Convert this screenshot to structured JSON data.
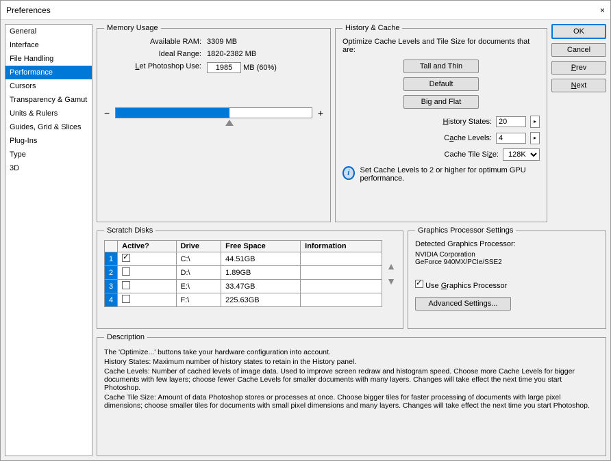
{
  "title": "Preferences",
  "sidebar": {
    "items": [
      {
        "label": "General"
      },
      {
        "label": "Interface"
      },
      {
        "label": "File Handling"
      },
      {
        "label": "Performance",
        "selected": true
      },
      {
        "label": "Cursors"
      },
      {
        "label": "Transparency & Gamut"
      },
      {
        "label": "Units & Rulers"
      },
      {
        "label": "Guides, Grid & Slices"
      },
      {
        "label": "Plug-Ins"
      },
      {
        "label": "Type"
      },
      {
        "label": "3D"
      }
    ]
  },
  "actions": {
    "ok": "OK",
    "cancel": "Cancel",
    "prev": "Prev",
    "next": "Next"
  },
  "memory": {
    "legend": "Memory Usage",
    "avail_label": "Available RAM:",
    "avail_value": "3309 MB",
    "ideal_label": "Ideal Range:",
    "ideal_value": "1820-2382 MB",
    "let_label": "Let Photoshop Use:",
    "let_value": "1985",
    "let_suffix": "MB (60%)"
  },
  "history": {
    "legend": "History & Cache",
    "intro": "Optimize Cache Levels and Tile Size for documents that are:",
    "btn_tall": "Tall and Thin",
    "btn_default": "Default",
    "btn_big": "Big and Flat",
    "hs_label": "History States:",
    "hs_value": "20",
    "cl_label": "Cache Levels:",
    "cl_value": "4",
    "cts_label": "Cache Tile Size:",
    "cts_value": "128K",
    "note": "Set Cache Levels to 2 or higher for optimum GPU performance."
  },
  "scratch": {
    "legend": "Scratch Disks",
    "cols": {
      "active": "Active?",
      "drive": "Drive",
      "free": "Free Space",
      "info": "Information"
    },
    "rows": [
      {
        "n": "1",
        "active": true,
        "drive": "C:\\",
        "free": "44.51GB",
        "info": ""
      },
      {
        "n": "2",
        "active": false,
        "drive": "D:\\",
        "free": "1.89GB",
        "info": ""
      },
      {
        "n": "3",
        "active": false,
        "drive": "E:\\",
        "free": "33.47GB",
        "info": ""
      },
      {
        "n": "4",
        "active": false,
        "drive": "F:\\",
        "free": "225.63GB",
        "info": ""
      }
    ]
  },
  "gpu": {
    "legend": "Graphics Processor Settings",
    "detected_label": "Detected Graphics Processor:",
    "vendor": "NVIDIA Corporation",
    "model": "GeForce 940MX/PCIe/SSE2",
    "use_label": "Use Graphics Processor",
    "use_checked": true,
    "adv": "Advanced Settings..."
  },
  "desc": {
    "legend": "Description",
    "p1": "The 'Optimize...' buttons take your hardware configuration into account.",
    "p2": "History States: Maximum number of history states to retain in the History panel.",
    "p3": "Cache Levels: Number of cached levels of image data.  Used to improve screen redraw and histogram speed.  Choose more Cache Levels for bigger documents with few layers; choose fewer Cache Levels for smaller documents with many layers. Changes will take effect the next time you start Photoshop.",
    "p4": "Cache Tile Size: Amount of data Photoshop stores or processes at once. Choose bigger tiles for faster processing of documents with large pixel dimensions; choose smaller tiles for documents with small pixel dimensions and many layers. Changes will take effect the next time you start Photoshop."
  }
}
